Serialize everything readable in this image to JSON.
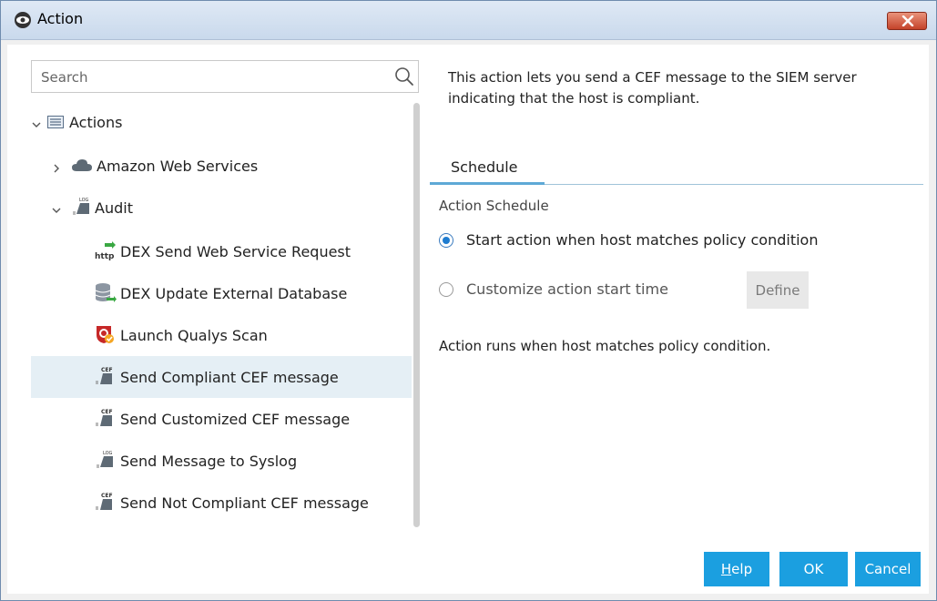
{
  "window": {
    "title": "Action",
    "close_icon": "close-icon"
  },
  "search": {
    "placeholder": "Search",
    "value": ""
  },
  "tree": {
    "root": {
      "label": "Actions",
      "icon": "list-icon"
    },
    "aws": {
      "label": "Amazon Web Services",
      "icon": "cloud-icon"
    },
    "audit": {
      "label": "Audit",
      "icon": "log-icon"
    },
    "items": [
      {
        "label": "DEX Send Web Service Request",
        "icon": "http-icon"
      },
      {
        "label": "DEX Update External Database",
        "icon": "database-icon"
      },
      {
        "label": "Launch Qualys Scan",
        "icon": "qualys-icon"
      },
      {
        "label": "Send Compliant CEF message",
        "icon": "cef-icon",
        "selected": true
      },
      {
        "label": "Send Customized CEF message",
        "icon": "cef-icon"
      },
      {
        "label": "Send Message to Syslog",
        "icon": "log-icon"
      },
      {
        "label": "Send Not Compliant CEF message",
        "icon": "cef-icon"
      }
    ]
  },
  "details": {
    "description": "This action lets you send a CEF message to the SIEM server indicating that the host is compliant.",
    "tab": "Schedule",
    "section_title": "Action Schedule",
    "option_start": "Start action when host matches policy condition",
    "option_custom": "Customize action start time",
    "define_label": "Define",
    "status": "Action runs when host matches policy condition."
  },
  "footer": {
    "help_prefix": "H",
    "help_rest": "elp",
    "ok_label": "OK",
    "cancel_label": "Cancel"
  },
  "colors": {
    "accent": "#1b9fe0",
    "selected_row": "#e5eff5",
    "tab_underline": "#5ea9d6"
  }
}
